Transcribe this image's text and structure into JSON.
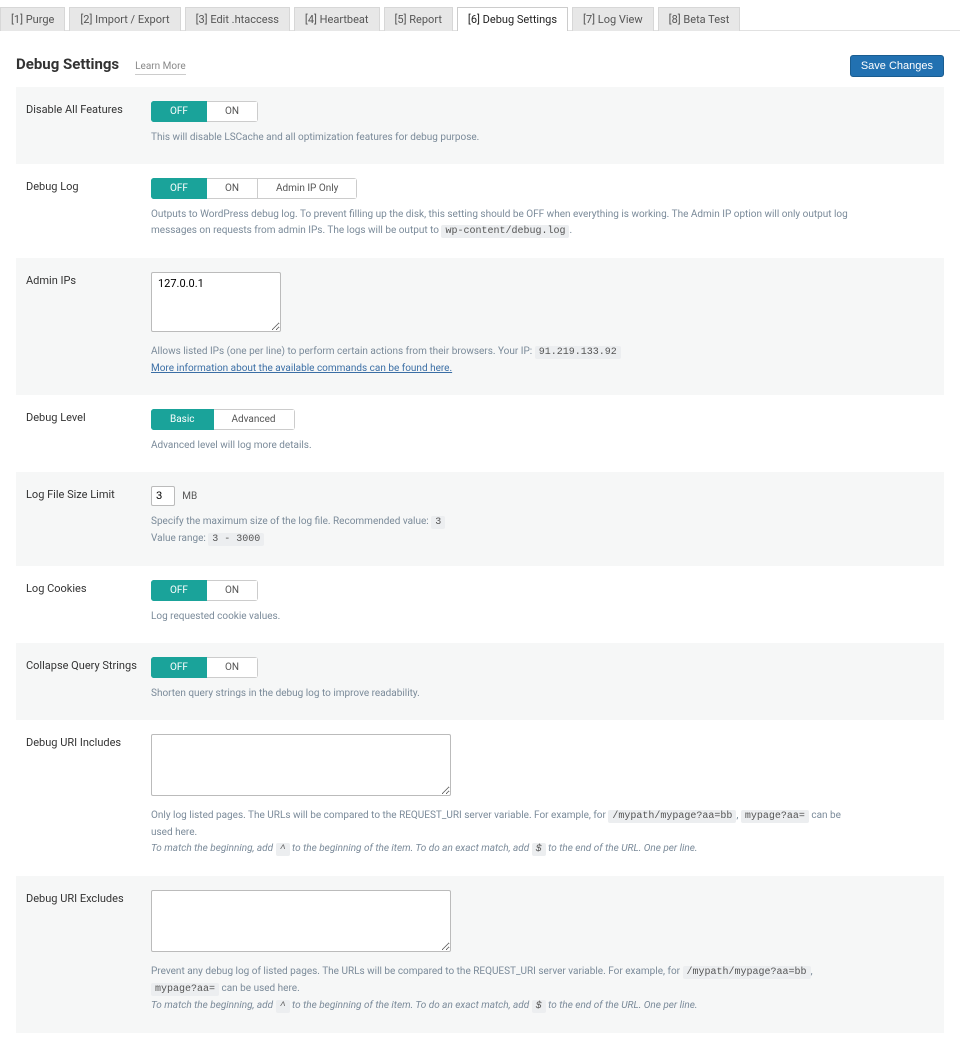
{
  "tabs": [
    {
      "label": "[1] Purge"
    },
    {
      "label": "[2] Import / Export"
    },
    {
      "label": "[3] Edit .htaccess"
    },
    {
      "label": "[4] Heartbeat"
    },
    {
      "label": "[5] Report"
    },
    {
      "label": "[6] Debug Settings"
    },
    {
      "label": "[7] Log View"
    },
    {
      "label": "[8] Beta Test"
    }
  ],
  "header": {
    "title": "Debug Settings",
    "learn_more": "Learn More",
    "save": "Save Changes"
  },
  "toggle": {
    "off": "OFF",
    "on": "ON"
  },
  "disable_all": {
    "label": "Disable All Features",
    "desc": "This will disable LSCache and all optimization features for debug purpose."
  },
  "debug_log": {
    "label": "Debug Log",
    "admin_only": "Admin IP Only",
    "desc_a": "Outputs to WordPress debug log. To prevent filling up the disk, this setting should be OFF when everything is working. The Admin IP option will only output log messages on requests from admin IPs. The logs will be output to ",
    "code": "wp-content/debug.log",
    "desc_b": "."
  },
  "admin_ips": {
    "label": "Admin IPs",
    "value": "127.0.0.1",
    "desc_a": "Allows listed IPs (one per line) to perform certain actions from their browsers. Your IP: ",
    "ip_code": "91.219.133.92",
    "link": "More information about the available commands can be found here."
  },
  "debug_level": {
    "label": "Debug Level",
    "basic": "Basic",
    "advanced": "Advanced",
    "desc": "Advanced level will log more details."
  },
  "log_size": {
    "label": "Log File Size Limit",
    "value": "3",
    "unit": "MB",
    "desc_a": "Specify the maximum size of the log file. Recommended value: ",
    "rec_code": "3",
    "desc_b": "Value range: ",
    "range_code": "3 - 3000"
  },
  "log_cookies": {
    "label": "Log Cookies",
    "desc": "Log requested cookie values."
  },
  "collapse_qs": {
    "label": "Collapse Query Strings",
    "desc": "Shorten query strings in the debug log to improve readability."
  },
  "uri_inc": {
    "label": "Debug URI Includes",
    "desc_a": "Only log listed pages. The URLs will be compared to the REQUEST_URI server variable. For example, for ",
    "code1": "/mypath/mypage?aa=bb",
    "sep": ", ",
    "code2": "mypage?aa=",
    "desc_b": " can be used here.",
    "hint_a": "To match the beginning, add ",
    "caret": "^",
    "hint_b": " to the beginning of the item. To do an exact match, add ",
    "dollar": "$",
    "hint_c": " to the end of the URL. One per line."
  },
  "uri_exc": {
    "label": "Debug URI Excludes",
    "desc_a": "Prevent any debug log of listed pages. The URLs will be compared to the REQUEST_URI server variable. For example, for ",
    "code1": "/mypath/mypage?aa=bb",
    "sep": ", ",
    "code2": "mypage?aa=",
    "desc_b": " can be used here.",
    "hint_a": "To match the beginning, add ",
    "caret": "^",
    "hint_b": " to the beginning of the item. To do an exact match, add ",
    "dollar": "$",
    "hint_c": " to the end of the URL. One per line."
  }
}
